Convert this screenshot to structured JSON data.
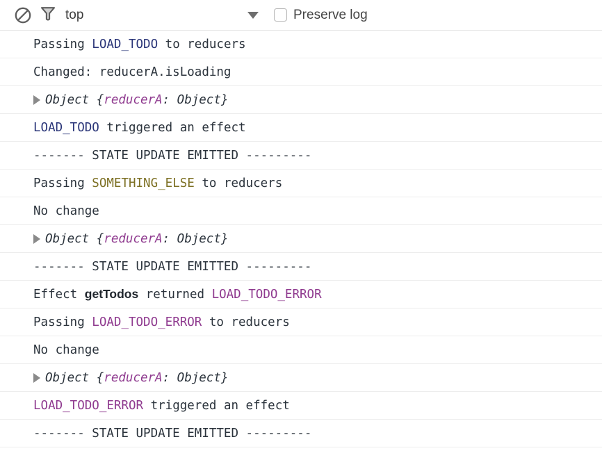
{
  "toolbar": {
    "clear_console": {
      "icon": "ban-circle-icon",
      "title": "Clear console"
    },
    "filter": {
      "icon": "filter-funnel-icon",
      "title": "Filter"
    },
    "context_selector": {
      "value": "top",
      "icon": "chevron-down-icon",
      "options": [
        "top"
      ]
    },
    "preserve_log": {
      "label": "Preserve log",
      "checked": false
    }
  },
  "colors": {
    "action_blue": "#2a3578",
    "action_olive": "#7d7024",
    "action_purple": "#8f3a8f",
    "text": "#2b333c",
    "row_border": "#ededed",
    "toolbar_border": "#e3e3e3",
    "background": "#ffffff"
  },
  "console": {
    "rows": [
      {
        "type": "text",
        "tokens": [
          {
            "text": "Passing ",
            "style": "plain"
          },
          {
            "text": "LOAD_TODO",
            "style": "blue"
          },
          {
            "text": " to reducers",
            "style": "plain"
          }
        ]
      },
      {
        "type": "text",
        "tokens": [
          {
            "text": "Changed: reducerA.isLoading",
            "style": "plain"
          }
        ]
      },
      {
        "type": "object",
        "tokens": [
          {
            "text": "Object {",
            "style": "plain italic"
          },
          {
            "text": "reducerA",
            "style": "purple italic"
          },
          {
            "text": ": Object}",
            "style": "plain italic"
          }
        ]
      },
      {
        "type": "text",
        "tokens": [
          {
            "text": "LOAD_TODO",
            "style": "blue"
          },
          {
            "text": " triggered an effect",
            "style": "plain"
          }
        ]
      },
      {
        "type": "text",
        "tokens": [
          {
            "text": "------- STATE UPDATE EMITTED ---------",
            "style": "plain"
          }
        ]
      },
      {
        "type": "text",
        "tokens": [
          {
            "text": "Passing ",
            "style": "plain"
          },
          {
            "text": "SOMETHING_ELSE",
            "style": "olive"
          },
          {
            "text": " to reducers",
            "style": "plain"
          }
        ]
      },
      {
        "type": "text",
        "tokens": [
          {
            "text": "No change",
            "style": "plain"
          }
        ]
      },
      {
        "type": "object",
        "tokens": [
          {
            "text": "Object {",
            "style": "plain italic"
          },
          {
            "text": "reducerA",
            "style": "purple italic"
          },
          {
            "text": ": Object}",
            "style": "plain italic"
          }
        ]
      },
      {
        "type": "text",
        "tokens": [
          {
            "text": "------- STATE UPDATE EMITTED ---------",
            "style": "plain"
          }
        ]
      },
      {
        "type": "text",
        "tokens": [
          {
            "text": "Effect ",
            "style": "plain"
          },
          {
            "text": "getTodos",
            "style": "bold-sans"
          },
          {
            "text": " returned ",
            "style": "plain"
          },
          {
            "text": "LOAD_TODO_ERROR",
            "style": "purple"
          }
        ]
      },
      {
        "type": "text",
        "tokens": [
          {
            "text": "Passing ",
            "style": "plain"
          },
          {
            "text": "LOAD_TODO_ERROR",
            "style": "purple"
          },
          {
            "text": " to reducers",
            "style": "plain"
          }
        ]
      },
      {
        "type": "text",
        "tokens": [
          {
            "text": "No change",
            "style": "plain"
          }
        ]
      },
      {
        "type": "object",
        "tokens": [
          {
            "text": "Object {",
            "style": "plain italic"
          },
          {
            "text": "reducerA",
            "style": "purple italic"
          },
          {
            "text": ": Object}",
            "style": "plain italic"
          }
        ]
      },
      {
        "type": "text",
        "tokens": [
          {
            "text": "LOAD_TODO_ERROR",
            "style": "purple"
          },
          {
            "text": " triggered an effect",
            "style": "plain"
          }
        ]
      },
      {
        "type": "text",
        "tokens": [
          {
            "text": "------- STATE UPDATE EMITTED ---------",
            "style": "plain"
          }
        ]
      }
    ]
  }
}
